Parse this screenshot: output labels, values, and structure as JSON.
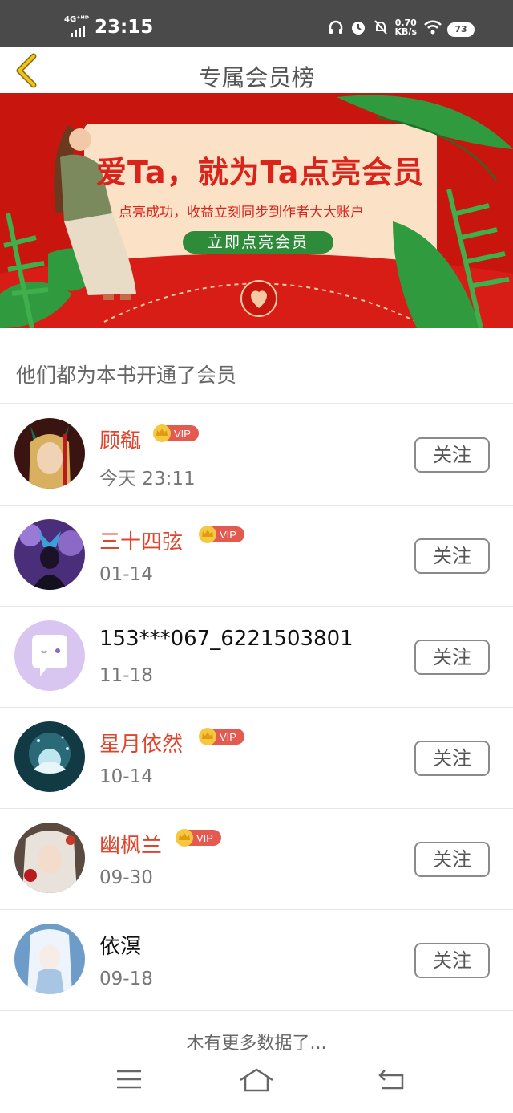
{
  "status": {
    "network": "4G⁺ᴴᴰ",
    "time": "23:15",
    "speed_value": "0.70",
    "speed_unit": "KB/s",
    "battery": "73"
  },
  "header": {
    "title": "专属会员榜"
  },
  "banner": {
    "title": "爱Ta，就为Ta点亮会员",
    "subtitle": "点亮成功，收益立刻同步到作者大大账户",
    "button": "立即点亮会员"
  },
  "section": {
    "title": "他们都为本书开通了会员"
  },
  "members": [
    {
      "name": "顾瓻",
      "date": "今天 23:11",
      "vip": true,
      "follow": "关注"
    },
    {
      "name": "三十四弦",
      "date": "01-14",
      "vip": true,
      "follow": "关注"
    },
    {
      "name": "153***067_6221503801",
      "date": "11-18",
      "vip": false,
      "follow": "关注"
    },
    {
      "name": "星月依然",
      "date": "10-14",
      "vip": true,
      "follow": "关注"
    },
    {
      "name": "幽枫兰",
      "date": "09-30",
      "vip": true,
      "follow": "关注"
    },
    {
      "name": "依溟",
      "date": "09-18",
      "vip": false,
      "follow": "关注"
    }
  ],
  "vip_label": "VIP",
  "footer": {
    "no_more": "木有更多数据了..."
  },
  "colors": {
    "vip_name": "#e0452c",
    "banner_red": "#cc1414",
    "button_green": "#2e8b3a"
  }
}
